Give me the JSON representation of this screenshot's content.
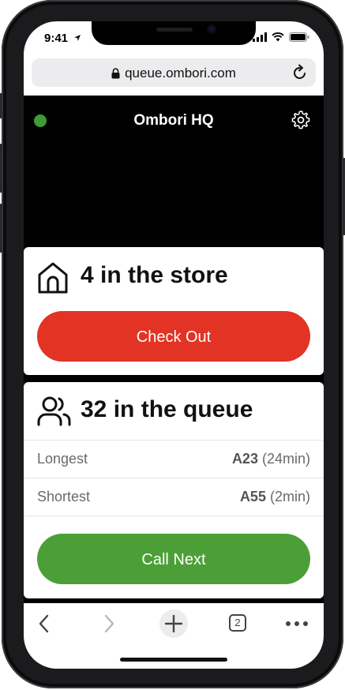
{
  "status_bar": {
    "time": "9:41"
  },
  "browser": {
    "url": "queue.ombori.com",
    "tab_count": "2"
  },
  "header": {
    "title": "Ombori HQ",
    "status_color": "#3f9b35"
  },
  "store": {
    "title": "4 in the store",
    "button_label": "Check Out",
    "button_color": "#e23325"
  },
  "queue": {
    "title": "32 in the queue",
    "rows": [
      {
        "label": "Longest",
        "ticket": "A23",
        "wait": "(24min)"
      },
      {
        "label": "Shortest",
        "ticket": "A55",
        "wait": "(2min)"
      }
    ],
    "button_label": "Call Next",
    "button_color": "#4c9f37"
  }
}
